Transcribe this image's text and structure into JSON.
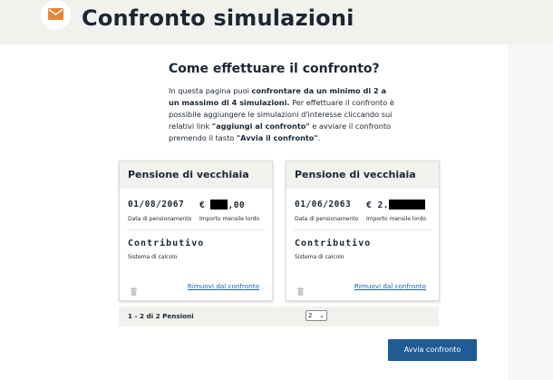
{
  "header": {
    "title": "Confronto simulazioni",
    "icon": "envelope-icon",
    "accent_color": "#e8843a"
  },
  "section": {
    "title": "Come effettuare il confronto?",
    "intro_1": "In questa pagina puoi ",
    "intro_2": "confrontare da un minimo di 2 a un massimo di 4 simulazioni.",
    "intro_3": " Per effettuare il confronto è possibile aggiungere le simulazioni d'interesse cliccando sui relativi link ",
    "intro_4": "\"aggiungi al confronto\"",
    "intro_5": " e avviare il confronto premendo il tasto ",
    "intro_6": "\"Avvia il confronto\"",
    "intro_7": "."
  },
  "cards": [
    {
      "title": "Pensione di vecchiaia",
      "date": "01/08/2067",
      "date_label": "Data di pensionamento",
      "amount_prefix": "€",
      "amount_suffix": ",00",
      "amount_label": "Importo mensile lordo",
      "calc_system": "Contributivo",
      "calc_label": "Sistema di calcolo",
      "remove_label": "Rimuovi dal confronto"
    },
    {
      "title": "Pensione di vecchiaia",
      "date": "01/06/2063",
      "date_label": "Data di pensionamento",
      "amount_prefix": "€ 2.",
      "amount_suffix": "",
      "amount_label": "Importo mensile lordo",
      "calc_system": "Contributivo",
      "calc_label": "Sistema di calcolo",
      "remove_label": "Rimuovi dal confronto"
    }
  ],
  "pager": {
    "text": "1 - 2 di 2 Pensioni",
    "selected": "2"
  },
  "actions": {
    "start_label": "Avvia confronto",
    "primary_color": "#1f5c93",
    "link_color": "#1a62a8"
  }
}
